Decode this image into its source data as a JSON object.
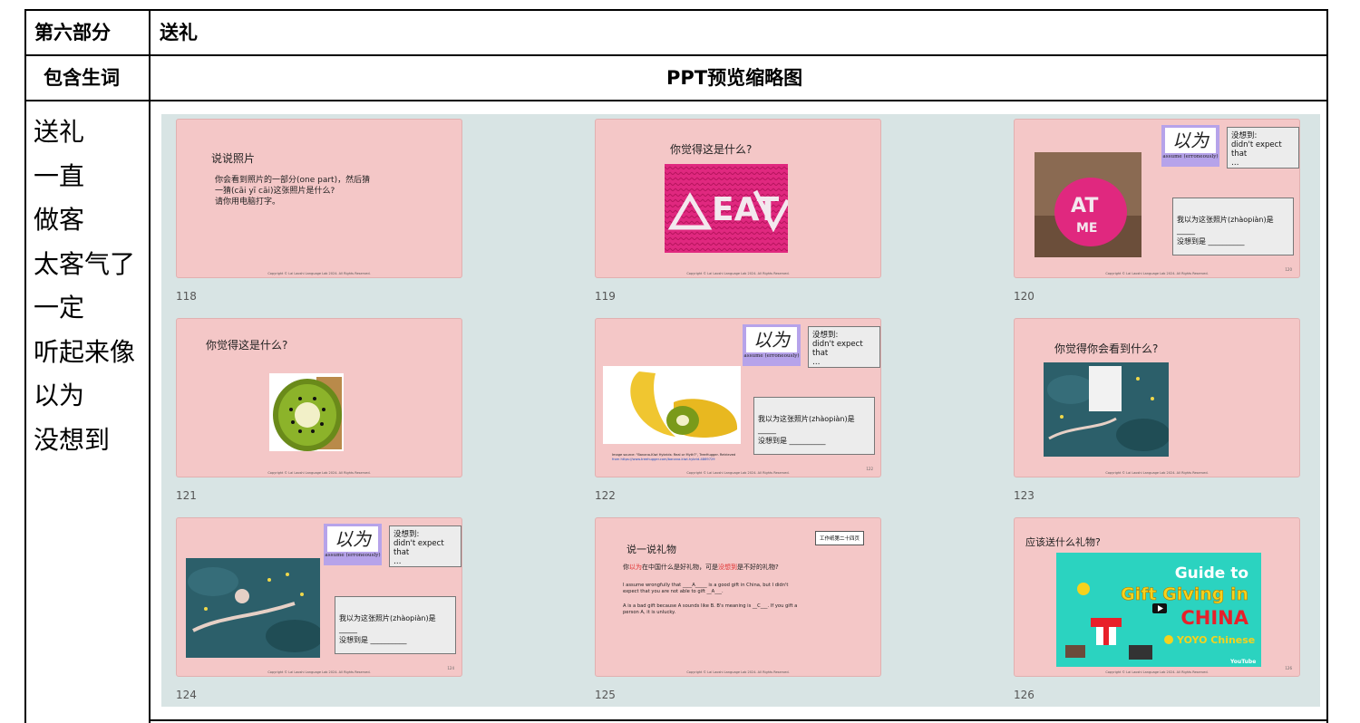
{
  "table": {
    "section_label": "第六部分",
    "section_title": "送礼",
    "vocab_header": "包含生词",
    "ppt_header": "PPT预览缩略图"
  },
  "vocab": [
    "送礼",
    "一直",
    "做客",
    "太客气了",
    "一定",
    "听起来像",
    "以为",
    "没想到"
  ],
  "copyright": "Copyright © Lai Laoshi Language Lab 2024. All Rights Reserved.",
  "common": {
    "yiwei": "以为",
    "yiwei_sub": "assume (erroneously)",
    "note_line1": "没想到:",
    "note_line2": "didn't expect that",
    "note_line3": "…",
    "fill_line1": "我以为这张照片(zhàopiàn)是 _____",
    "fill_line2": "没想到是 __________",
    "guess_title": "你觉得这是什么?"
  },
  "slides": [
    {
      "number": "118",
      "title": "说说照片",
      "body1": "你会看到照片的一部分(one part)，然后猜",
      "body2": "一猜(cāi yī cāi)这张照片是什么?",
      "body3": "请你用电脑打字。"
    },
    {
      "number": "119",
      "image": "pink-knit-hat-photo",
      "hat_text": "EAT"
    },
    {
      "number": "120",
      "image": "apple-in-knit-cover-photo",
      "corner": "120"
    },
    {
      "number": "121",
      "image": "kiwi-half-photo"
    },
    {
      "number": "122",
      "image": "banana-kiwi-photo",
      "corner": "122",
      "source1": "Image source: \"Banana-Kiwi Hybrids: Real or Myth?\", TreeHugger. Retrieved",
      "source2": "from https://www.treehugger.com/banana-kiwi-hybrid-4869729"
    },
    {
      "number": "123",
      "title": "你觉得你会看到什么?",
      "image": "underwater-snorkeler-photo-partially-covered"
    },
    {
      "number": "124",
      "image": "underwater-snorkeler-photo",
      "corner": "124"
    },
    {
      "number": "125",
      "title": "说一说礼物",
      "worksheet": "工作纸第二十四页",
      "q_prefix": "你",
      "q_red1": "以为",
      "q_mid": "在中国什么是好礼物，可是",
      "q_red2": "没想到",
      "q_suffix": "是不好的礼物?",
      "en1": "I assume wrongfully that ____A_____ is a good gift in China, but I didn't",
      "en2": "expect that you are not able to gift __A___.",
      "en3": "A is a bad gift because A sounds like B. B's meaning is __C___. If you gift a",
      "en4": "person A, it is unlucky."
    },
    {
      "number": "126",
      "title": "应该送什么礼物?",
      "corner": "126",
      "video": {
        "line1": "Guide to",
        "line2": "Gift Giving in",
        "line3": "CHINA",
        "brand": "YOYO Chinese",
        "platform": "YouTube"
      }
    }
  ],
  "colors": {
    "slide_bg": "#f4c7c7",
    "grid_bg": "#d8e4e4",
    "yiwei_bg": "#b6a3ea",
    "video_bg": "#2bd3c0",
    "video_yellow": "#f6d21c",
    "video_red": "#e8202a"
  }
}
